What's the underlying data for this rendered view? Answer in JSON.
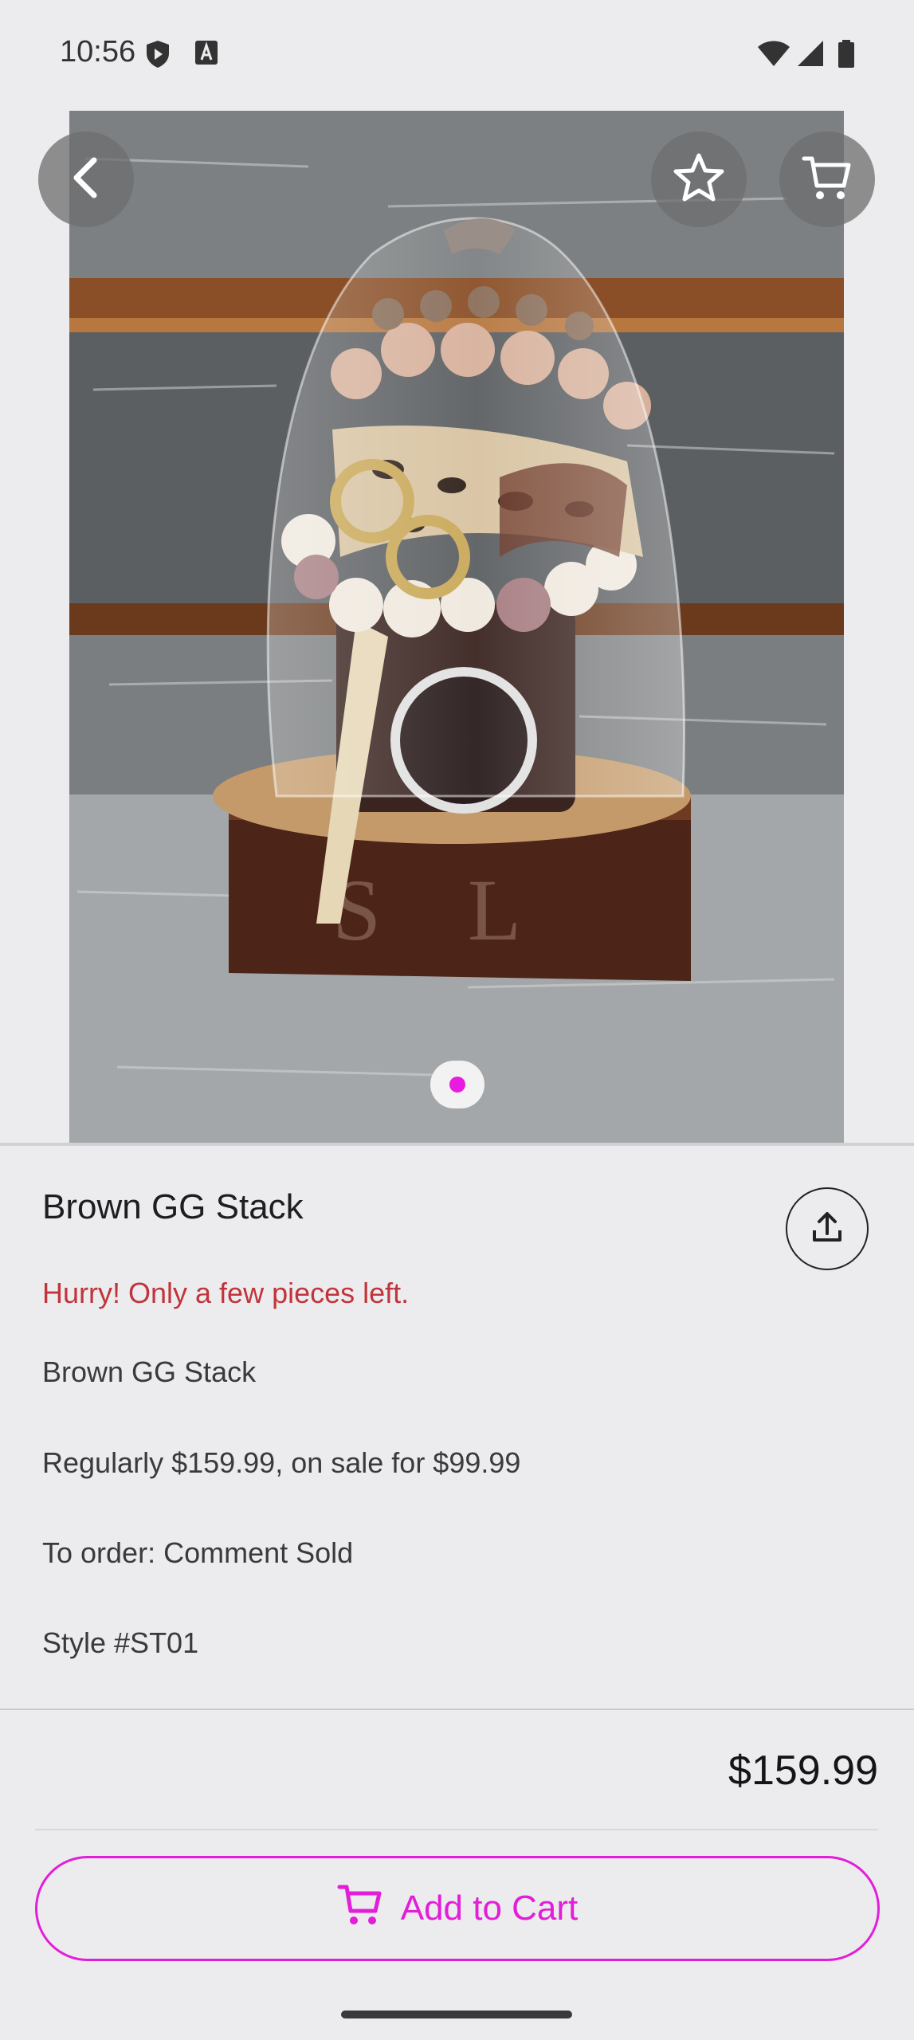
{
  "status_bar": {
    "time": "10:56",
    "icons": [
      "shield-icon",
      "font-a-icon",
      "wifi-icon",
      "signal-icon",
      "battery-icon"
    ]
  },
  "gallery": {
    "image_alt": "Brown GG bracelet stack on display stand",
    "image_count": 1,
    "active_index": 0
  },
  "toolbar": {
    "back_icon": "chevron-left-icon",
    "favorite_icon": "star-outline-icon",
    "cart_icon": "cart-icon"
  },
  "product": {
    "title": "Brown GG Stack",
    "stock_warning": "Hurry! Only a few pieces left.",
    "description_lines": [
      "Brown GG Stack",
      "Regularly $159.99, on sale for $99.99",
      "To order: Comment Sold",
      "Style #ST01"
    ],
    "price": "$159.99"
  },
  "actions": {
    "share_icon": "share-icon",
    "add_to_cart_label": "Add to Cart"
  },
  "colors": {
    "accent": "#e21ed8",
    "warning": "#c2343b",
    "background": "#ececef"
  }
}
